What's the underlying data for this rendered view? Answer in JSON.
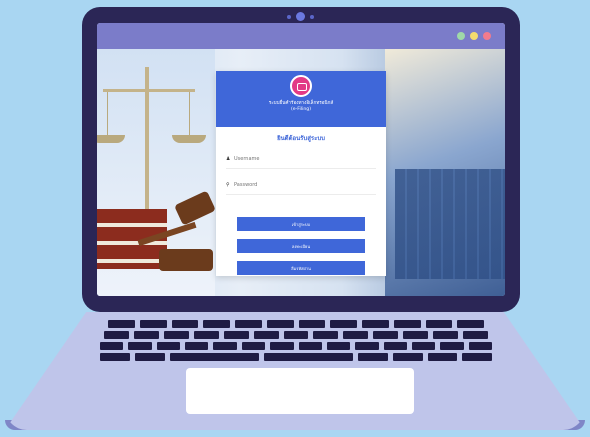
{
  "window": {
    "controls": [
      "minimize-dot",
      "maximize-dot",
      "close-dot"
    ],
    "colors": {
      "green": "#9fd9a8",
      "yellow": "#f4dc6e",
      "red": "#f27b8c"
    }
  },
  "login_card": {
    "system_title": "ระบบยื่นคำร้องทางอิเล็กทรอนิกส์",
    "system_subtitle": "(e-Filing)",
    "welcome": "ยินดีต้อนรับสู่ระบบ",
    "username": {
      "placeholder": "Username",
      "value": "",
      "icon": "user-icon"
    },
    "password": {
      "placeholder": "Password",
      "value": "",
      "icon": "key-icon"
    },
    "buttons": {
      "login": "เข้าสู่ระบบ",
      "register": "ลงทะเบียน",
      "forgot_password": "ลืมรหัสผ่าน"
    }
  },
  "colors": {
    "accent": "#3f67d9",
    "logo": "#e23a86",
    "background": "#a9d6f2",
    "laptop_frame": "#2b2656"
  }
}
